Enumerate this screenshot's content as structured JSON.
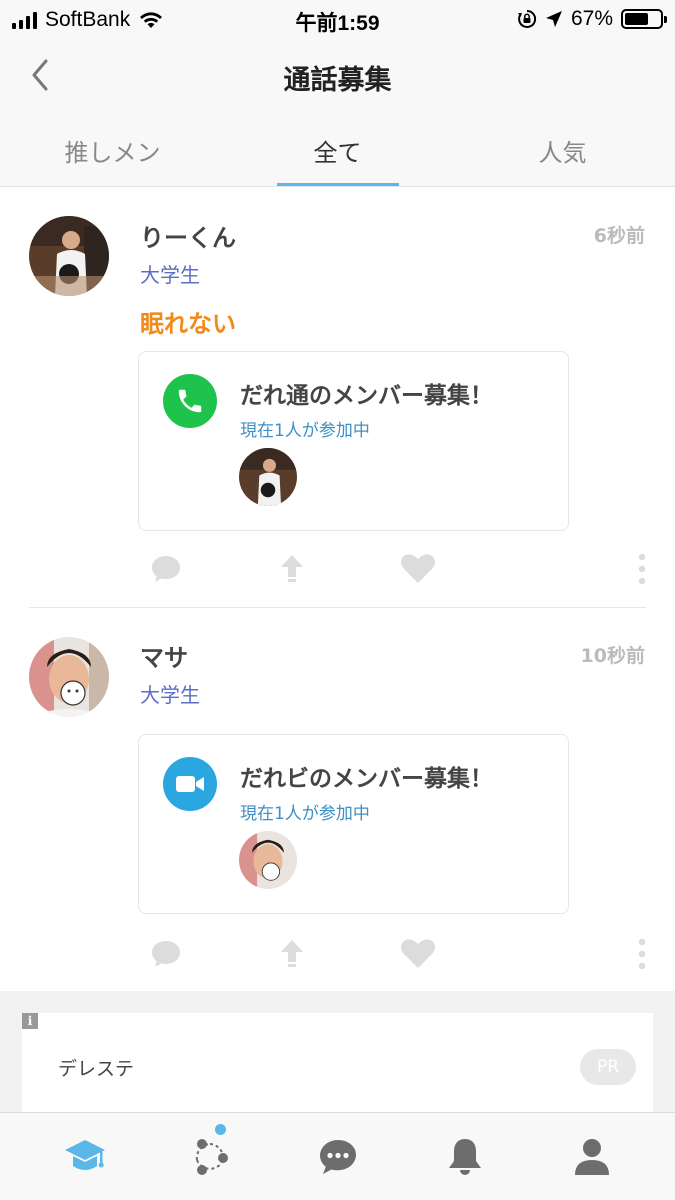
{
  "status_bar": {
    "carrier": "SoftBank",
    "time": "午前1:59",
    "battery": "67%",
    "battery_level": 0.67
  },
  "nav": {
    "title": "通話募集",
    "back_icon": "chevron-left-icon"
  },
  "tabs": [
    {
      "label": "推しメン",
      "active": false
    },
    {
      "label": "全て",
      "active": true
    },
    {
      "label": "人気",
      "active": false
    }
  ],
  "posts": [
    {
      "name": "りーくん",
      "time": "6秒前",
      "role": "大学生",
      "message": "眠れない",
      "card": {
        "type": "phone",
        "icon": "phone-icon",
        "icon_color": "#1fc24a",
        "title": "だれ通のメンバー募集！",
        "subtitle": "現在1人が参加中"
      }
    },
    {
      "name": "マサ",
      "time": "10秒前",
      "role": "大学生",
      "message": "",
      "card": {
        "type": "video",
        "icon": "video-camera-icon",
        "icon_color": "#2aa6e0",
        "title": "だれビのメンバー募集！",
        "subtitle": "現在1人が参加中"
      }
    }
  ],
  "actions": [
    "comment-icon",
    "share-icon",
    "heart-icon",
    "more-vertical-icon"
  ],
  "ad": {
    "text": "デレステ",
    "badge": "PR",
    "info": "i"
  },
  "bottom_nav": [
    {
      "icon": "graduation-cap-icon",
      "active": true
    },
    {
      "icon": "connections-icon",
      "active": false,
      "badge_dot": true
    },
    {
      "icon": "chat-bubble-icon",
      "active": false
    },
    {
      "icon": "bell-icon",
      "active": false
    },
    {
      "icon": "profile-icon",
      "active": false
    }
  ],
  "colors": {
    "accent": "#5bb7e8",
    "role": "#5a6fc4",
    "message": "#f08a1c",
    "icon_gray": "#6d6d6d",
    "action_gray": "#dcdcdc"
  }
}
